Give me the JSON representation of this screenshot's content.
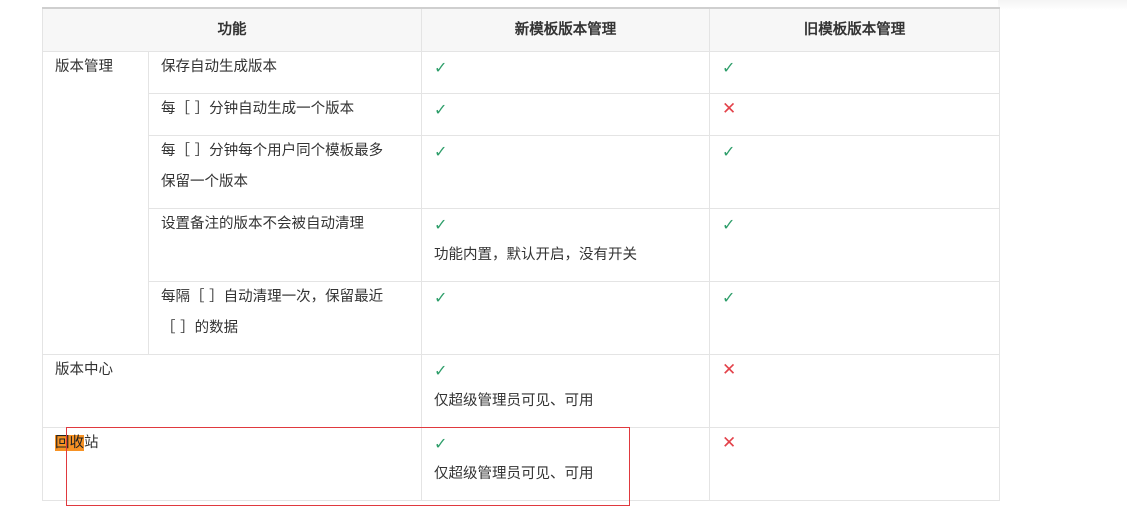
{
  "header": {
    "feature": "功能",
    "new_version": "新模板版本管理",
    "old_version": "旧模板版本管理"
  },
  "marks": {
    "ok": "✓",
    "no": "✕"
  },
  "rows": [
    {
      "group": "版本管理",
      "feature": [
        "保存自动生成版本"
      ],
      "new_note": "",
      "new": "ok",
      "old": "ok"
    },
    {
      "feature": [
        "每［ ］分钟自动生成一个版本"
      ],
      "new_note": "",
      "new": "ok",
      "old": "no"
    },
    {
      "feature": [
        "每［ ］分钟每个用户同个模板最多",
        "保留一个版本"
      ],
      "new_note": "",
      "new": "ok",
      "old": "ok"
    },
    {
      "feature": [
        "设置备注的版本不会被自动清理"
      ],
      "new_note": "功能内置，默认开启，没有开关",
      "new": "ok",
      "old": "ok"
    },
    {
      "feature": [
        "每隔［ ］自动清理一次，保留最近",
        "［ ］的数据"
      ],
      "new_note": "",
      "new": "ok",
      "old": "ok"
    }
  ],
  "version_center": {
    "feature": "版本中心",
    "new_note": "仅超级管理员可见、可用",
    "new": "ok",
    "old": "no"
  },
  "recycle_bin": {
    "feature_highlight": "回收",
    "feature_rest": "站",
    "new_note": "仅超级管理员可见、可用",
    "new": "ok",
    "old": "no"
  },
  "colors": {
    "ok": "#2e9e6a",
    "no": "#e3424a",
    "highlight": "#f79224",
    "annotation_box": "#e0393e"
  }
}
